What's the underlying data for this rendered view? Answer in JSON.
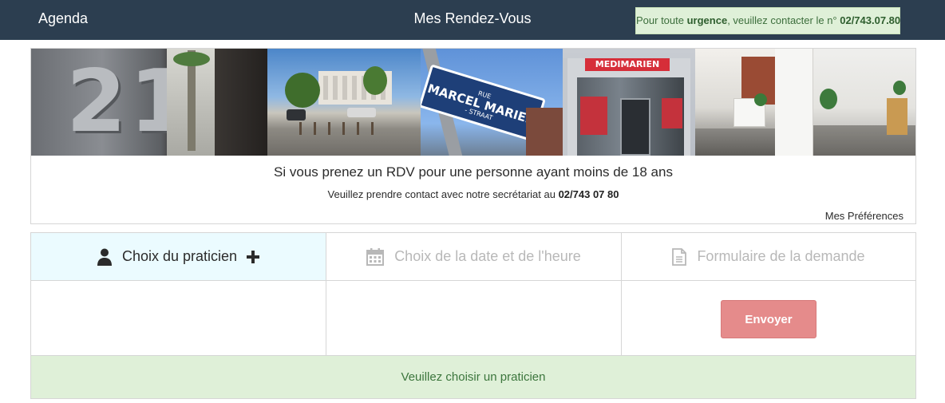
{
  "navbar": {
    "brand": "Agenda",
    "title": "Mes Rendez-Vous",
    "urgence": {
      "prefix": "Pour toute ",
      "highlight": "urgence",
      "middle": ", veuillez contacter le n° ",
      "phone": "02/743.07.80"
    }
  },
  "banner": {
    "number_sign": "21",
    "street_sign": {
      "top": "RUE",
      "name": "MARCEL MARIEN",
      "bottom": "- STRAAT"
    },
    "facade_logo": "MEDIMARIEN"
  },
  "notice": {
    "title": "Si vous prenez un RDV pour une personne ayant moins de 18 ans",
    "sub_prefix": "Veuillez prendre contact avec notre secrétariat au ",
    "sub_phone": "02/743 07 80",
    "preferences_link": "Mes Préférences"
  },
  "steps": [
    {
      "label": "Choix du praticien",
      "icon": "user-icon",
      "active": true
    },
    {
      "label": "Choix de la date et de l'heure",
      "icon": "calendar-icon",
      "active": false
    },
    {
      "label": "Formulaire de la demande",
      "icon": "document-icon",
      "active": false
    }
  ],
  "actions": {
    "send_label": "Envoyer"
  },
  "alert": {
    "message": "Veuillez choisir un praticien"
  },
  "colors": {
    "navbar_bg": "#2c3e50",
    "active_step_bg": "#ebfbff",
    "send_button_bg": "#e58b8b",
    "alert_bg": "#dff0d8",
    "alert_text": "#3c763d"
  }
}
